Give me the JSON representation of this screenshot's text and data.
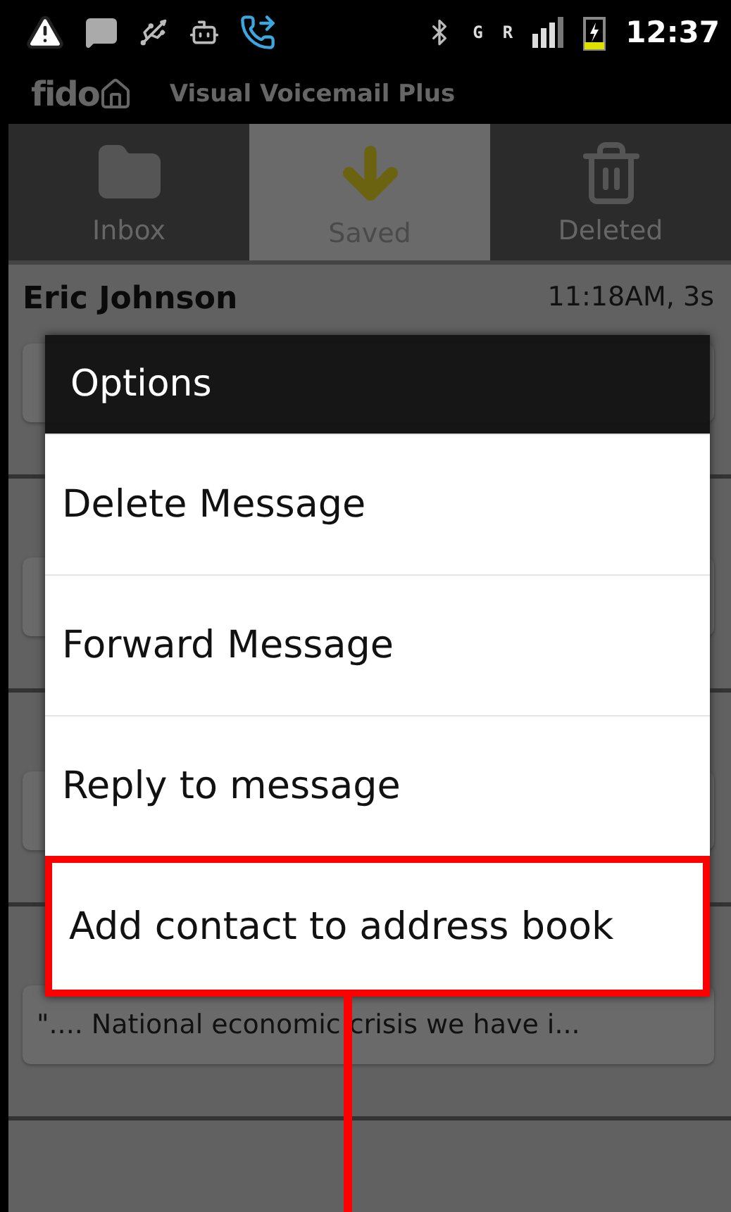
{
  "status_bar": {
    "time": "12:37",
    "network": "G",
    "roaming": "R"
  },
  "app_bar": {
    "logo": "fido",
    "title": "Visual Voicemail Plus"
  },
  "tabs": [
    {
      "label": "Inbox",
      "kind": "folder",
      "selected": false
    },
    {
      "label": "Saved",
      "kind": "saved",
      "selected": true
    },
    {
      "label": "Deleted",
      "kind": "trash",
      "selected": false
    }
  ],
  "messages": [
    {
      "kind": "message",
      "caller": "Eric Johnson",
      "meta": "11:18AM, 3s"
    },
    {
      "kind": "covered"
    },
    {
      "kind": "covered"
    },
    {
      "kind": "message",
      "transcript": "\".... National economic crisis we have i..."
    }
  ],
  "dialog": {
    "title": "Options",
    "items": [
      {
        "label": "Delete Message",
        "highlighted": false
      },
      {
        "label": "Forward Message",
        "highlighted": false
      },
      {
        "label": "Reply to message",
        "highlighted": false
      },
      {
        "label": "Add contact to address book",
        "highlighted": true
      }
    ]
  }
}
